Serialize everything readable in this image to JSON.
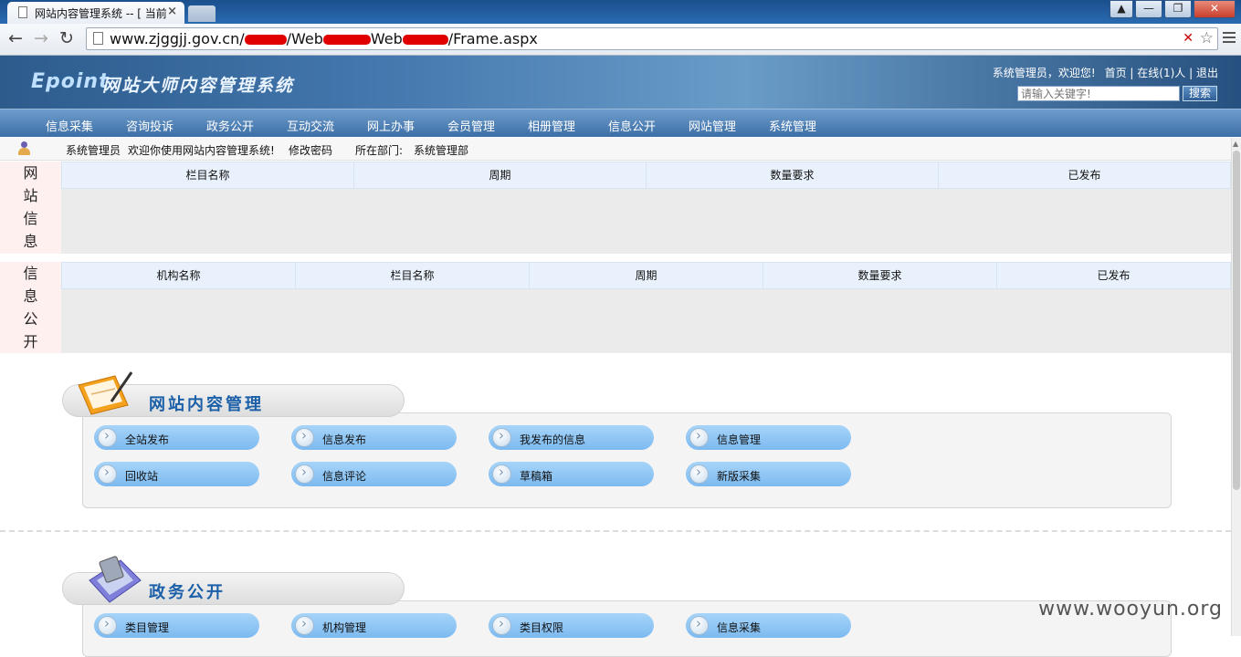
{
  "browser": {
    "tab_title": "网站内容管理系统 -- [ 当前",
    "tab_close": "×",
    "window_buttons": [
      "▲",
      "—",
      "❐",
      "✕"
    ],
    "url_domain": "www.zjggjj.gov.cn/",
    "url_part_2": "/Web",
    "url_part_3": "Web",
    "url_part_4": "/Frame.aspx",
    "back_glyph": "←",
    "forward_glyph": "→",
    "reload_glyph": "↻",
    "star_glyph": "☆",
    "blocked_glyph": "✕"
  },
  "header": {
    "logo": "Epoint",
    "system_name": "网站大师内容管理系统",
    "greeting": "系统管理员，欢迎您!",
    "home_link": "首页",
    "online_link": "在线(1)人",
    "logout_link": "退出",
    "separator": "|",
    "search_placeholder": "请输入关键字!",
    "search_button": "搜索"
  },
  "nav": {
    "items": [
      "信息采集",
      "咨询投诉",
      "政务公开",
      "互动交流",
      "网上办事",
      "会员管理",
      "相册管理",
      "信息公开",
      "网站管理",
      "系统管理"
    ]
  },
  "welcome": {
    "user": "系统管理员",
    "message": "欢迎你使用网站内容管理系统!",
    "change_password": "修改密码",
    "dept_label": "所在部门:",
    "dept_value": "系统管理部"
  },
  "website_info": {
    "side_label": [
      "网",
      "站",
      "信",
      "息"
    ],
    "columns": [
      "栏目名称",
      "周期",
      "数量要求",
      "已发布"
    ]
  },
  "info_public": {
    "side_label": [
      "信",
      "息",
      "公",
      "开"
    ],
    "columns": [
      "机构名称",
      "栏目名称",
      "周期",
      "数量要求",
      "已发布"
    ]
  },
  "content_mgmt": {
    "title": "网站内容管理",
    "buttons": [
      "全站发布",
      "信息发布",
      "我发布的信息",
      "信息管理",
      "回收站",
      "信息评论",
      "草稿箱",
      "新版采集"
    ]
  },
  "gov_public": {
    "title": "政务公开",
    "buttons": [
      "类目管理",
      "机构管理",
      "类目权限",
      "信息采集"
    ]
  },
  "watermark": "www.wooyun.org"
}
